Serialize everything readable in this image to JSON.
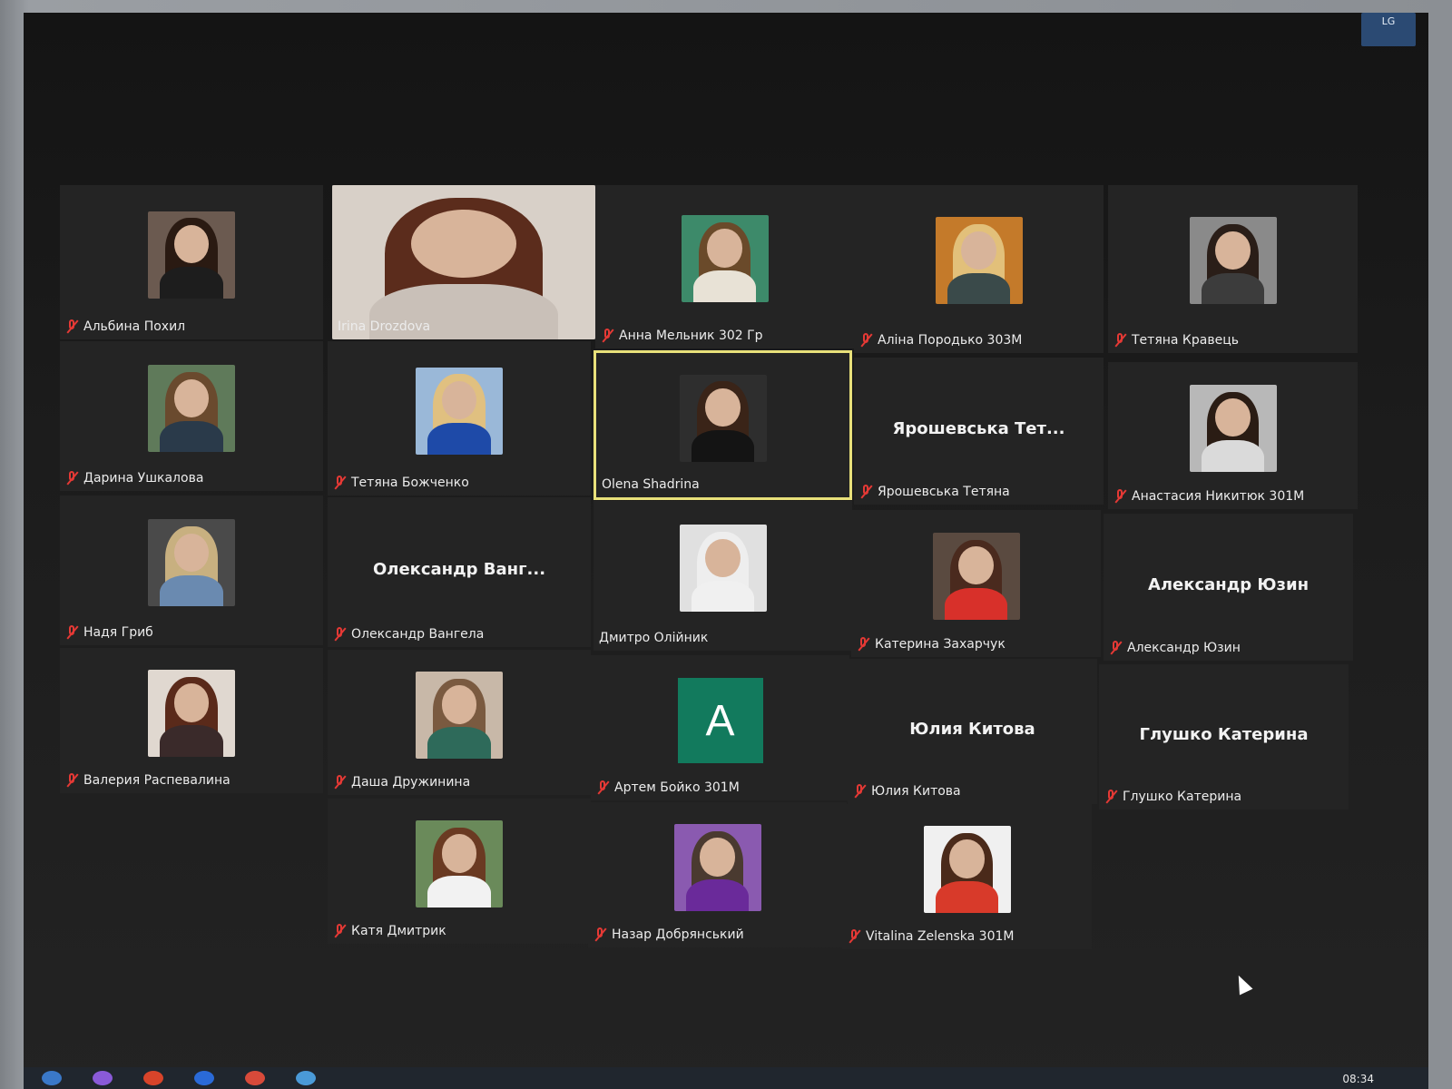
{
  "bezel": {
    "brand": "LG"
  },
  "tiles": [
    {
      "kind": "photo",
      "name": "Альбина Похил",
      "muted": true,
      "hair": "#2a1a12",
      "body": "#1d1d1d",
      "bg": "#6b5a50"
    },
    {
      "kind": "video",
      "name": "Irina Drozdova",
      "muted": false,
      "hair": "#5b2c1c",
      "body": "#c9c0b8",
      "bg": "#d8d0c8"
    },
    {
      "kind": "photo",
      "name": "Анна Мельник 302 Гр",
      "muted": true,
      "hair": "#6a4a2a",
      "body": "#e8e2d6",
      "bg": "#3d8a6a"
    },
    {
      "kind": "photo",
      "name": "Аліна Породько 303М",
      "muted": true,
      "hair": "#e2c07a",
      "body": "#3a4a4a",
      "bg": "#c47a2a"
    },
    {
      "kind": "photo",
      "name": "Тетяна Кравець",
      "muted": true,
      "hair": "#2a1e18",
      "body": "#3c3c3c",
      "bg": "#8a8a8a"
    },
    {
      "kind": "photo",
      "name": "Дарина Ушкалова",
      "muted": true,
      "hair": "#6a4a2e",
      "body": "#2a3a4a",
      "bg": "#5f7a5a"
    },
    {
      "kind": "photo",
      "name": "Тетяна Божченко",
      "muted": true,
      "hair": "#e0c080",
      "body": "#1e4aa8",
      "bg": "#9ab8d8"
    },
    {
      "kind": "photo",
      "name": "Olena Shadrina",
      "muted": false,
      "active": true,
      "hair": "#3a2418",
      "body": "#141414",
      "bg": "#2e2e2e"
    },
    {
      "kind": "text",
      "name": "Ярошевська Тетяна",
      "display": "Ярошевська  Тет...",
      "muted": true
    },
    {
      "kind": "photo",
      "name": "Анастасия Никитюк 301М",
      "muted": true,
      "hair": "#2a1c14",
      "body": "#dadada",
      "bg": "#b8b8b8"
    },
    {
      "kind": "photo",
      "name": "Надя Гриб",
      "muted": true,
      "hair": "#c8b080",
      "body": "#6a8ab0",
      "bg": "#4a4a4a"
    },
    {
      "kind": "text",
      "name": "Олександр Вангела",
      "display": "Олександр  Ванг...",
      "muted": true
    },
    {
      "kind": "photo",
      "name": "Дмитро Олійник",
      "muted": false,
      "hair": "#eeeeee",
      "body": "#f0f0f0",
      "bg": "#e0e0e0"
    },
    {
      "kind": "photo",
      "name": "Катерина Захарчук",
      "muted": true,
      "hair": "#4a2a1e",
      "body": "#d8302a",
      "bg": "#5a4a40"
    },
    {
      "kind": "text",
      "name": "Александр Юзин",
      "display": "Александр  Юзин",
      "muted": true
    },
    {
      "kind": "photo",
      "name": "Валерия Распевалина",
      "muted": true,
      "hair": "#5a2a1a",
      "body": "#3a2a2a",
      "bg": "#e0d8d0"
    },
    {
      "kind": "photo",
      "name": "Даша Дружинина",
      "muted": true,
      "hair": "#7a5a40",
      "body": "#2e6a5a",
      "bg": "#c8b8a8"
    },
    {
      "kind": "initial",
      "name": "Артем Бойко 301М",
      "letter": "A",
      "muted": true
    },
    {
      "kind": "text",
      "name": "Юлия Китова",
      "display": "Юлия  Китова",
      "muted": true
    },
    {
      "kind": "text",
      "name": "Глушко Катерина",
      "display": "Глушко  Катерина",
      "muted": true
    },
    {
      "kind": "photo",
      "name": "Катя Дмитрик",
      "muted": true,
      "hair": "#6a3a22",
      "body": "#f2f2f2",
      "bg": "#6a8a5a"
    },
    {
      "kind": "photo",
      "name": "Назар Добрянський",
      "muted": true,
      "hair": "#4a3a30",
      "body": "#6a2a9a",
      "bg": "#8a5ab0"
    },
    {
      "kind": "photo",
      "name": "Vitalina Zelenska 301M",
      "muted": true,
      "hair": "#4a2a1a",
      "body": "#d83a2a",
      "bg": "#f0f0f0"
    }
  ],
  "taskbar": {
    "clock": "08:34"
  },
  "colors": {
    "active_border": "#e8e07a",
    "muted_icon": "#e53935",
    "initial_bg": "#127a5d"
  }
}
